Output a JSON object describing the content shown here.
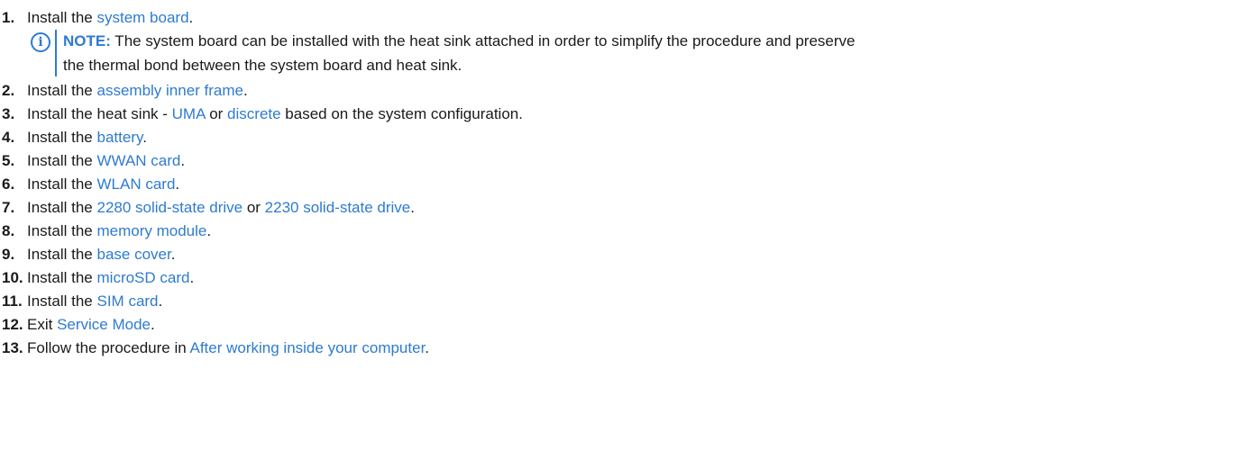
{
  "steps": [
    {
      "num": "1.",
      "pre": "Install the ",
      "link": "system board",
      "post": "."
    },
    {
      "num": "2.",
      "pre": "Install the ",
      "link": "assembly inner frame",
      "post": "."
    },
    {
      "num": "3.",
      "pre": "Install the heat sink - ",
      "link": "UMA",
      "mid": " or ",
      "link2": "discrete",
      "post": " based on the system configuration."
    },
    {
      "num": "4.",
      "pre": "Install the ",
      "link": "battery",
      "post": "."
    },
    {
      "num": "5.",
      "pre": "Install the ",
      "link": "WWAN card",
      "post": "."
    },
    {
      "num": "6.",
      "pre": "Install the ",
      "link": "WLAN card",
      "post": "."
    },
    {
      "num": "7.",
      "pre": "Install the ",
      "link": "2280 solid-state drive",
      "mid": " or ",
      "link2": "2230 solid-state drive",
      "post": "."
    },
    {
      "num": "8.",
      "pre": "Install the ",
      "link": "memory module",
      "post": "."
    },
    {
      "num": "9.",
      "pre": "Install the ",
      "link": "base cover",
      "post": "."
    },
    {
      "num": "10.",
      "pre": "Install the ",
      "link": "microSD card",
      "post": "."
    },
    {
      "num": "11.",
      "pre": "Install the ",
      "link": "SIM card",
      "post": "."
    },
    {
      "num": "12.",
      "pre": "Exit ",
      "link": "Service Mode",
      "post": "."
    },
    {
      "num": "13.",
      "pre": "Follow the procedure in ",
      "link": "After working inside your computer",
      "post": "."
    }
  ],
  "note": {
    "icon": "info-icon",
    "icon_glyph": "i",
    "label": "NOTE:",
    "line1": " The system board can be installed with the heat sink attached in order to simplify the procedure and preserve",
    "line2": "the thermal bond between the system board and heat sink."
  },
  "colors": {
    "link": "#2e7bcf",
    "text": "#1a1a1a"
  }
}
